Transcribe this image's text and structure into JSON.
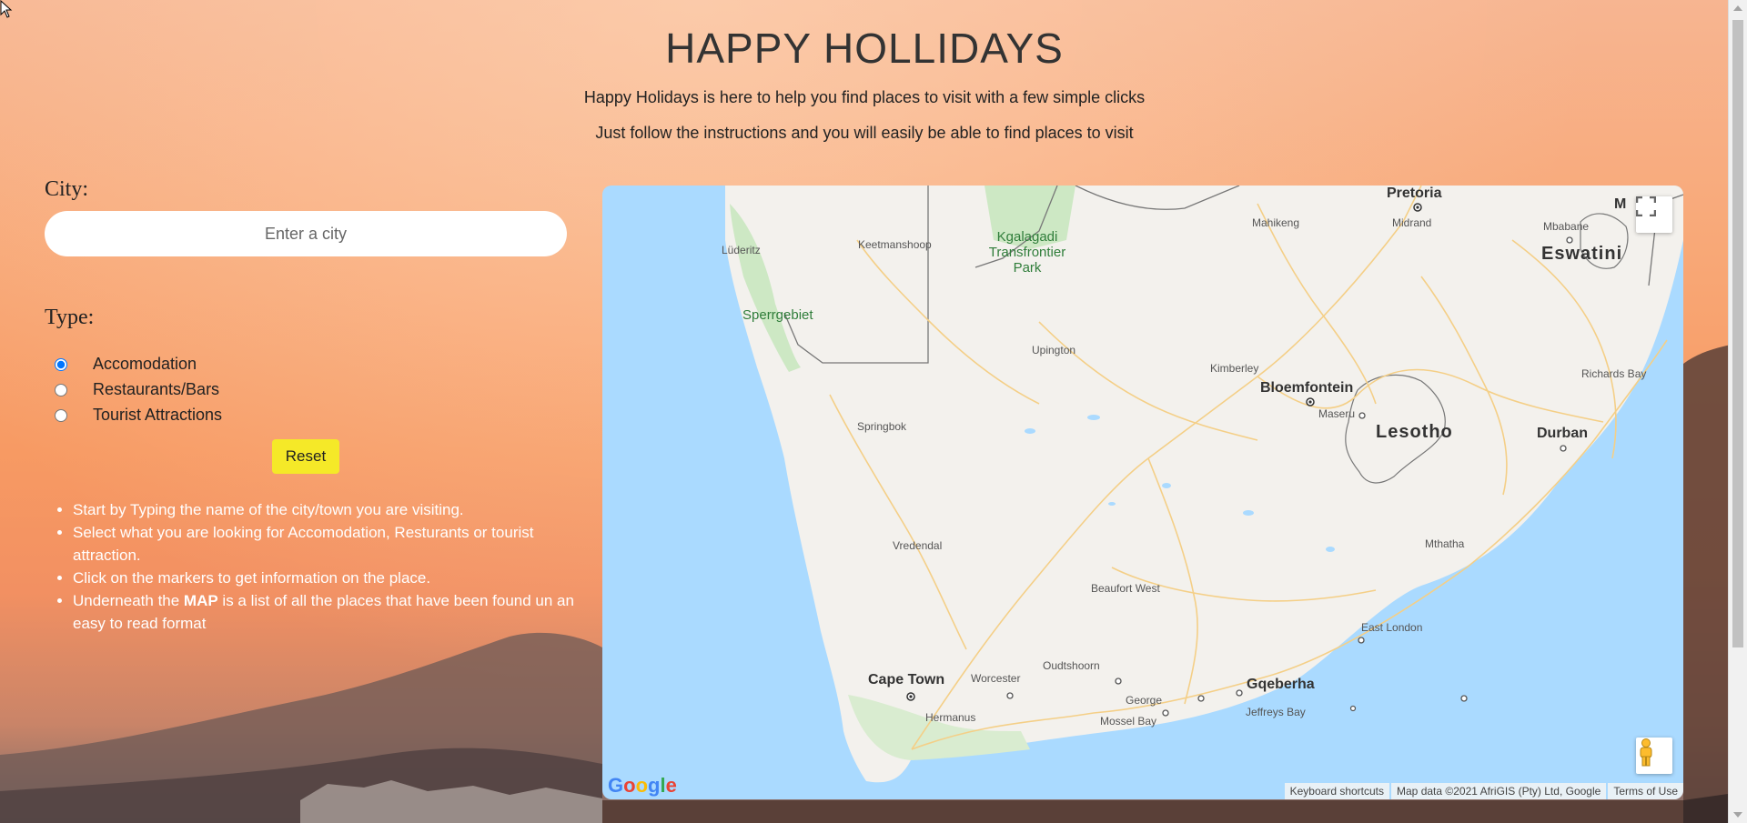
{
  "header": {
    "title": "HAPPY HOLLIDAYS",
    "subtitle_1": "Happy Holidays is here to help you find places to visit with a few simple clicks",
    "subtitle_2": "Just follow the instructions and you will easily be able to find places to visit"
  },
  "form": {
    "city_label": "City:",
    "city_placeholder": "Enter a city",
    "city_value": "",
    "type_label": "Type:",
    "types": [
      {
        "label": "Accomodation",
        "checked": true
      },
      {
        "label": "Restaurants/Bars",
        "checked": false
      },
      {
        "label": "Tourist Attractions",
        "checked": false
      }
    ],
    "reset_label": "Reset"
  },
  "instructions": [
    "Start by Typing the name of the city/town you are visiting.",
    "Select what you are looking for Accomodation, Resturants or tourist attraction.",
    "Click on the markers to get information on the place.",
    {
      "prefix": "Underneath the ",
      "bold": "MAP",
      "suffix": " is a list of all the places that have been found un an easy to read format"
    }
  ],
  "map": {
    "places": {
      "pretoria": "Pretoria",
      "midrand": "Midrand",
      "mahikeng": "Mahikeng",
      "mbabane": "Mbabane",
      "eswatini": "Eswatini",
      "m_partial": "M",
      "keetmanshoop": "Keetmanshoop",
      "luderitz": "Lüderitz",
      "kgalagadi": "Kgalagadi Transfrontier Park",
      "sperrgebiet": "Sperrgebiet",
      "upington": "Upington",
      "kimberley": "Kimberley",
      "bloemfontein": "Bloemfontein",
      "maseru": "Maseru",
      "lesotho": "Lesotho",
      "richards_bay": "Richards Bay",
      "durban": "Durban",
      "springbok": "Springbok",
      "vredendal": "Vredendal",
      "beaufort_west": "Beaufort West",
      "mthatha": "Mthatha",
      "east_london": "East London",
      "oudtshoorn": "Oudtshoorn",
      "cape_town": "Cape Town",
      "worcester": "Worcester",
      "george": "George",
      "gqeberha": "Gqeberha",
      "hermanus": "Hermanus",
      "mossel_bay": "Mossel Bay",
      "jeffreys_bay": "Jeffreys Bay"
    },
    "google_logo": "Google",
    "attribution": {
      "shortcuts": "Keyboard shortcuts",
      "data": "Map data ©2021 AfriGIS (Pty) Ltd, Google",
      "terms": "Terms of Use"
    },
    "colors": {
      "water": "#aadaff",
      "land": "#f3f1ed",
      "park": "#cde8c4",
      "border": "#777777",
      "road": "#f4cf87"
    }
  }
}
